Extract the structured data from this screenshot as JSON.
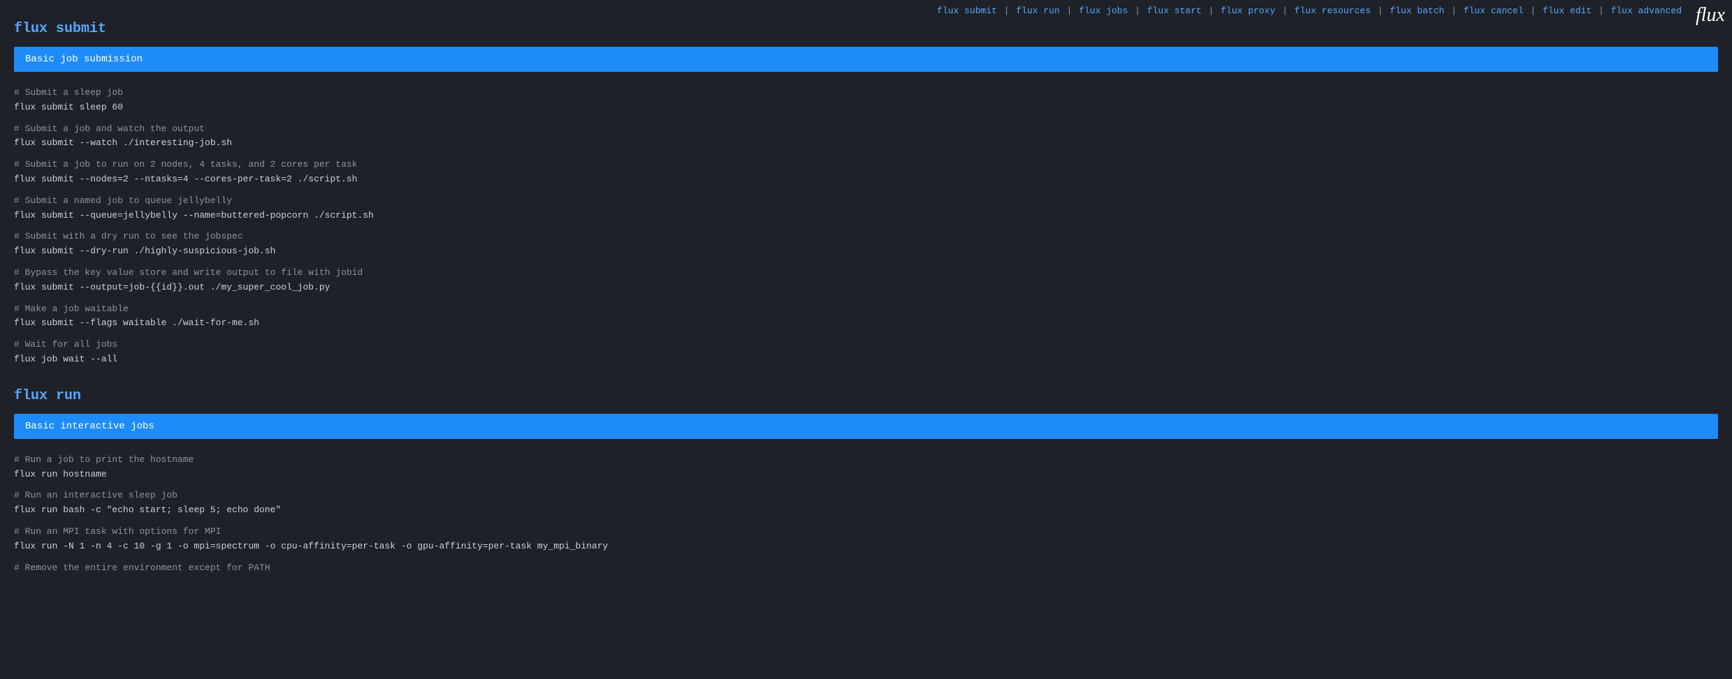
{
  "nav": {
    "links": [
      {
        "label": "flux submit",
        "id": "nav-flux-submit"
      },
      {
        "label": "flux run",
        "id": "nav-flux-run"
      },
      {
        "label": "flux jobs",
        "id": "nav-flux-jobs"
      },
      {
        "label": "flux start",
        "id": "nav-flux-start"
      },
      {
        "label": "flux proxy",
        "id": "nav-flux-proxy"
      },
      {
        "label": "flux resources",
        "id": "nav-flux-resources"
      },
      {
        "label": "flux batch",
        "id": "nav-flux-batch"
      },
      {
        "label": "flux cancel",
        "id": "nav-flux-cancel"
      },
      {
        "label": "flux edit",
        "id": "nav-flux-edit"
      },
      {
        "label": "flux advanced",
        "id": "nav-flux-advanced"
      }
    ]
  },
  "logo": "flux",
  "sections": [
    {
      "id": "section-flux-submit",
      "title": "flux submit",
      "bar_label": "Basic job submission",
      "commands": [
        {
          "comment": "# Submit a sleep job",
          "command": "flux submit sleep 60"
        },
        {
          "comment": "# Submit a job and watch the output",
          "command": "flux submit --watch ./interesting-job.sh"
        },
        {
          "comment": "# Submit a job to run on 2 nodes, 4 tasks, and 2 cores per task",
          "command": "flux submit --nodes=2 --ntasks=4 --cores-per-task=2 ./script.sh"
        },
        {
          "comment": "# Submit a named job to queue jellybelly",
          "command": "flux submit --queue=jellybelly --name=buttered-popcorn ./script.sh"
        },
        {
          "comment": "# Submit with a dry run to see the jobspec",
          "command": "flux submit --dry-run ./highly-suspicious-job.sh"
        },
        {
          "comment": "# Bypass the key value store and write output to file with jobid",
          "command": "flux submit --output=job-{{id}}.out ./my_super_cool_job.py"
        },
        {
          "comment": "# Make a job waitable",
          "command": "flux submit --flags waitable ./wait-for-me.sh"
        },
        {
          "comment": "# Wait for all jobs",
          "command": "flux job wait --all"
        }
      ]
    },
    {
      "id": "section-flux-run",
      "title": "flux run",
      "bar_label": "Basic interactive jobs",
      "commands": [
        {
          "comment": "# Run a job to print the hostname",
          "command": "flux run hostname"
        },
        {
          "comment": "# Run an interactive sleep job",
          "command": "flux run bash -c \"echo start; sleep 5; echo done\""
        },
        {
          "comment": "# Run an MPI task with options for MPI",
          "command": "flux run -N 1 -n 4 -c 10 -g 1 -o mpi=spectrum -o cpu-affinity=per-task -o gpu-affinity=per-task my_mpi_binary"
        },
        {
          "comment": "# Remove the entire environment except for PATH",
          "command": ""
        }
      ]
    }
  ]
}
